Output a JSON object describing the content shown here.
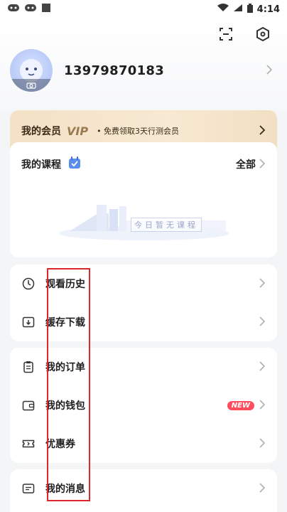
{
  "status_bar": {
    "time": "4:14"
  },
  "profile": {
    "phone": "13979870183"
  },
  "vip": {
    "title": "我的会员",
    "tag": "VIP",
    "desc": "• 免费领取3天行测会员"
  },
  "courses": {
    "title": "我的课程",
    "all_label": "全部",
    "empty_text": "今日暂无课程"
  },
  "menu": {
    "group1": [
      {
        "label": "观看历史",
        "icon": "clock-icon"
      },
      {
        "label": "缓存下载",
        "icon": "download-icon"
      }
    ],
    "group2": [
      {
        "label": "我的订单",
        "icon": "clipboard-icon"
      },
      {
        "label": "我的钱包",
        "icon": "wallet-icon",
        "badge": "NEW"
      },
      {
        "label": "优惠券",
        "icon": "coupon-icon"
      }
    ],
    "group3": [
      {
        "label": "我的消息",
        "icon": "message-icon"
      }
    ]
  },
  "colors": {
    "highlight": "#e0262b",
    "badge": "#ff4d5e",
    "vip_bg": "#f4e1c6"
  }
}
